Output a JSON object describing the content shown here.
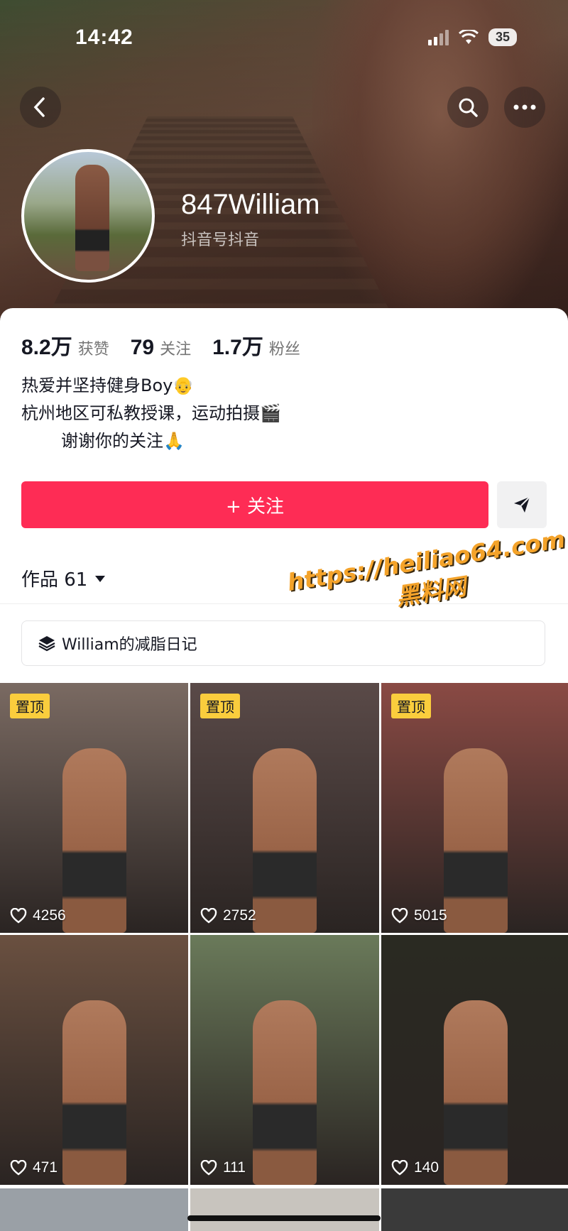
{
  "status_bar": {
    "time": "14:42",
    "battery": "35"
  },
  "profile": {
    "username": "847William",
    "subtitle": "抖音号抖音"
  },
  "stats": [
    {
      "value": "8.2万",
      "label": "获赞"
    },
    {
      "value": "79",
      "label": "关注"
    },
    {
      "value": "1.7万",
      "label": "粉丝"
    }
  ],
  "bio": {
    "line1": "热爱并坚持健身Boy👴",
    "line2": "杭州地区可私教授课，运动拍摄🎬",
    "line3": "谢谢你的关注🙏"
  },
  "actions": {
    "follow_label": "+ 关注"
  },
  "works": {
    "label": "作品 61"
  },
  "collection": {
    "label": "William的减脂日记"
  },
  "watermark": {
    "line1": "https://heiliao64.com",
    "line2": "黑料网"
  },
  "videos": [
    {
      "likes": "4256",
      "pinned": true,
      "pin_label": "置顶",
      "bg": "#7a6a62"
    },
    {
      "likes": "2752",
      "pinned": true,
      "pin_label": "置顶",
      "bg": "#5a4a48"
    },
    {
      "likes": "5015",
      "pinned": true,
      "pin_label": "置顶",
      "bg": "#8a4a44"
    },
    {
      "likes": "471",
      "pinned": false,
      "bg": "#6a5040"
    },
    {
      "likes": "111",
      "pinned": false,
      "bg": "#6a7a5a"
    },
    {
      "likes": "140",
      "pinned": false,
      "bg": "#2a2a22"
    }
  ],
  "colors": {
    "accent": "#fe2c55",
    "pin": "#facd3d",
    "watermark": "#f4a32a"
  }
}
